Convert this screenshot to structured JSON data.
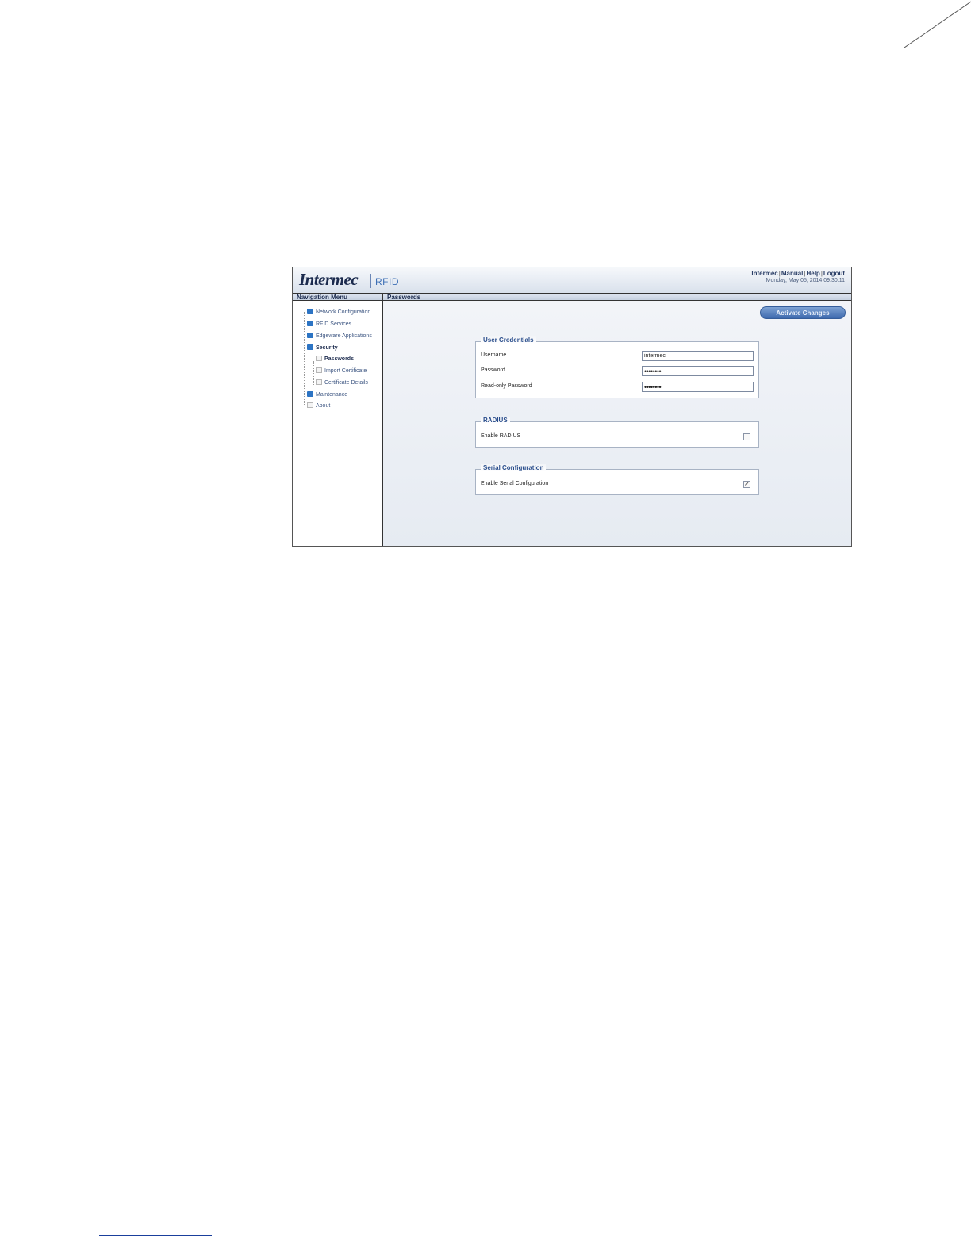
{
  "header": {
    "logo": "Intermec",
    "product": "RFID",
    "links": [
      "Intermec",
      "Manual",
      "Help",
      "Logout"
    ],
    "datetime": "Monday, May 05, 2014 09:30:11"
  },
  "nav": {
    "title": "Navigation Menu",
    "items": [
      {
        "label": "Network Configuration"
      },
      {
        "label": "RFID Services"
      },
      {
        "label": "Edgeware Applications"
      },
      {
        "label": "Security"
      },
      {
        "label": "Passwords"
      },
      {
        "label": "Import Certificate"
      },
      {
        "label": "Certificate Details"
      },
      {
        "label": "Maintenance"
      },
      {
        "label": "About"
      }
    ]
  },
  "main": {
    "title": "Passwords",
    "activate_label": "Activate Changes",
    "user_credentials": {
      "title": "User Credentials",
      "username_label": "Username",
      "username_value": "intermec",
      "password_label": "Password",
      "password_value": "••••••••",
      "readonly_label": "Read-only Password",
      "readonly_value": "••••••••"
    },
    "radius": {
      "title": "RADIUS",
      "enable_label": "Enable RADIUS",
      "enabled": false
    },
    "serial": {
      "title": "Serial Configuration",
      "enable_label": "Enable Serial Configuration",
      "enabled": true
    }
  }
}
